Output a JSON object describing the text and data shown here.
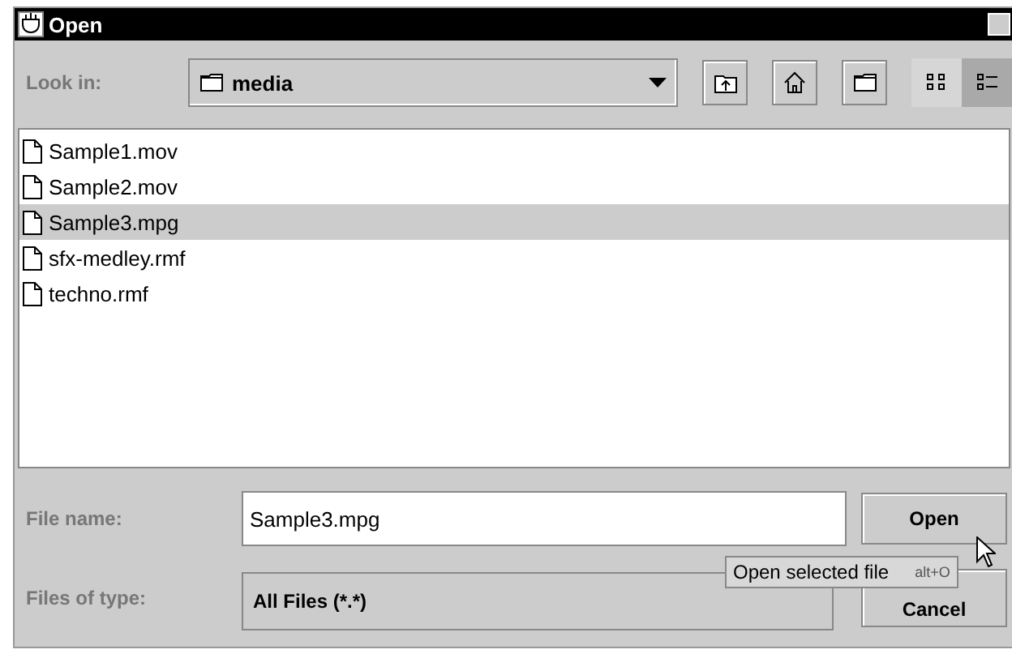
{
  "window": {
    "title": "Open"
  },
  "look_in": {
    "label": "Look in:",
    "value": "media"
  },
  "toolbar": [
    {
      "kind": "up"
    },
    {
      "kind": "home"
    },
    {
      "kind": "new-folder"
    },
    {
      "kind": "list",
      "selected": false
    },
    {
      "kind": "details",
      "selected": true
    }
  ],
  "files": [
    {
      "name": "Sample1.mov",
      "selected": false
    },
    {
      "name": "Sample2.mov",
      "selected": false
    },
    {
      "name": "Sample3.mpg",
      "selected": true
    },
    {
      "name": "sfx-medley.rmf",
      "selected": false
    },
    {
      "name": "techno.rmf",
      "selected": false
    }
  ],
  "file_name": {
    "label": "File name:",
    "value": "Sample3.mpg"
  },
  "file_type": {
    "label": "Files of type:",
    "value": "All Files (*.*)"
  },
  "buttons": [
    {
      "label": "Open"
    },
    {
      "label": "Cancel"
    }
  ],
  "tooltip": {
    "text": "Open selected file",
    "shortcut": "alt+O"
  }
}
